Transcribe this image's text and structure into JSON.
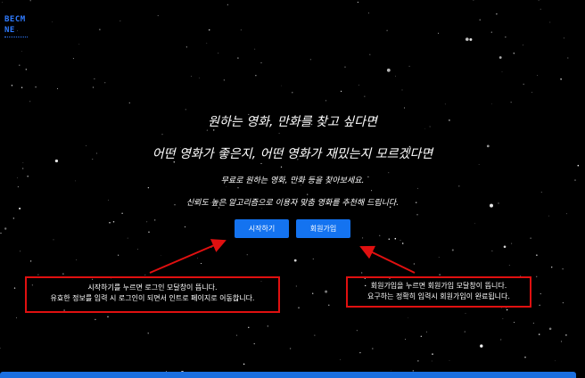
{
  "logo": {
    "line1": "BECM",
    "line2": "NE"
  },
  "hero": {
    "title_line1": "원하는 영화, 만화를 찾고 싶다면",
    "title_line2": "어떤 영화가 좋은지, 어떤 영화가 재밌는지 모르겠다면",
    "subtitle1": "무료로 원하는 영화, 만화 등을 찾아보세요.",
    "subtitle2": "신뢰도 높은 알고리즘으로 이용자 맞춤 영화를 추천해 드립니다."
  },
  "buttons": {
    "start_label": "시작하기",
    "signup_label": "회원가입"
  },
  "annotations": {
    "left_line1": "시작하기를 누르면 로그인 모달창이 뜹니다.",
    "left_line2": "유효한 정보를 입력 시 로그인이 되면서 인트로 페이지로 이동합니다.",
    "right_line1": "회원가입을 누르면 회원가입 모달창이 뜹니다.",
    "right_line2": "요구하는 정확히 입력시 회원가입이 완료됩니다."
  },
  "colors": {
    "accent": "#1473f0",
    "annotation": "#e01010",
    "background": "#000000"
  }
}
